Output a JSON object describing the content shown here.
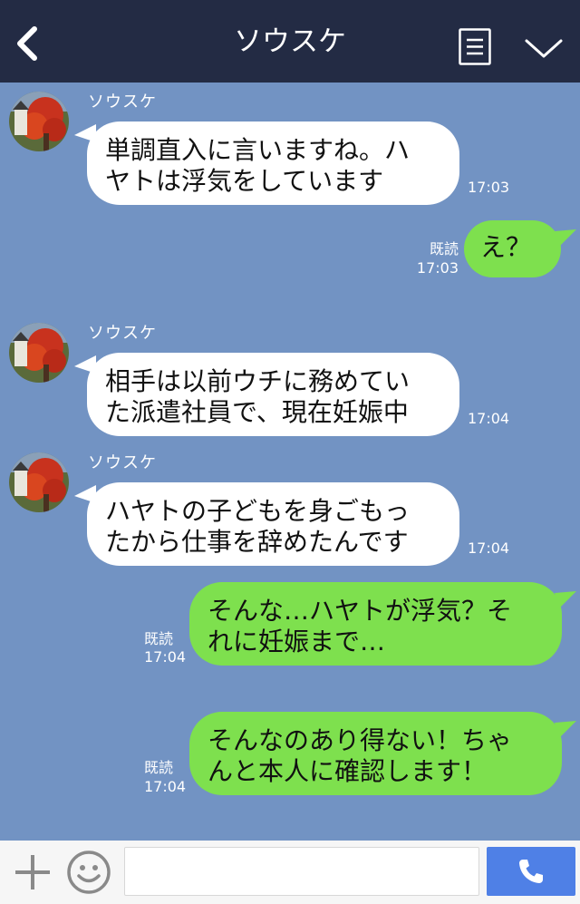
{
  "header": {
    "title": "ソウスケ",
    "back_icon": "chevron-left-icon",
    "menu_icon": "list-menu-icon",
    "collapse_icon": "chevron-down-icon"
  },
  "messages": [
    {
      "side": "in",
      "sender": "ソウスケ",
      "lines": [
        "単調直入に言いますね。ハ",
        "ヤトは浮気をしています"
      ],
      "time": "17:03"
    },
    {
      "side": "out",
      "read": "既読",
      "lines": [
        "え？"
      ],
      "time": "17:03"
    },
    {
      "side": "in",
      "sender": "ソウスケ",
      "lines": [
        "相手は以前ウチに務めてい",
        "た派遣社員で、現在妊娠中"
      ],
      "time": "17:04"
    },
    {
      "side": "in",
      "sender": "ソウスケ",
      "lines": [
        "ハヤトの子どもを身ごもっ",
        "たから仕事を辞めたんです"
      ],
      "time": "17:04"
    },
    {
      "side": "out",
      "read": "既読",
      "lines": [
        "そんな…ハヤトが浮気？そ",
        "れに妊娠まで…"
      ],
      "time": "17:04"
    },
    {
      "side": "out",
      "read": "既読",
      "lines": [
        "そんなのあり得ない！ちゃ",
        "んと本人に確認します！"
      ],
      "time": "17:04"
    }
  ],
  "footer": {
    "plus_icon": "plus-icon",
    "emoji_icon": "smiley-icon",
    "input_value": "",
    "call_icon": "phone-icon"
  },
  "colors": {
    "header_bg": "#232b44",
    "chat_bg": "#7293c3",
    "incoming_bubble": "#ffffff",
    "outgoing_bubble": "#7ee04e",
    "call_button": "#4f80e6"
  }
}
